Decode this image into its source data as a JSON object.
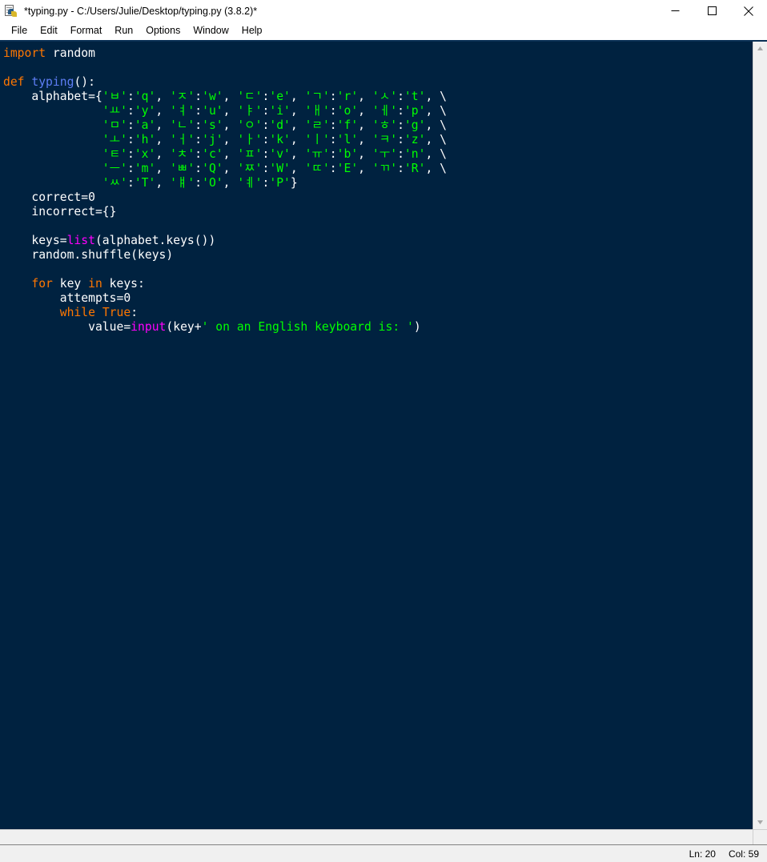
{
  "window": {
    "title": "*typing.py - C:/Users/Julie/Desktop/typing.py (3.8.2)*",
    "icon": "python-file-icon",
    "controls": {
      "minimize": "minimize-icon",
      "maximize": "maximize-icon",
      "close": "close-icon"
    }
  },
  "menubar": {
    "items": [
      {
        "label": "File"
      },
      {
        "label": "Edit"
      },
      {
        "label": "Format"
      },
      {
        "label": "Run"
      },
      {
        "label": "Options"
      },
      {
        "label": "Window"
      },
      {
        "label": "Help"
      }
    ]
  },
  "editor": {
    "lines": [
      [
        {
          "t": "import",
          "c": "kw"
        },
        {
          "t": " random",
          "c": "norm"
        }
      ],
      [
        {
          "t": "",
          "c": "norm"
        }
      ],
      [
        {
          "t": "def",
          "c": "kw"
        },
        {
          "t": " ",
          "c": "norm"
        },
        {
          "t": "typing",
          "c": "def"
        },
        {
          "t": "():",
          "c": "norm"
        }
      ],
      [
        {
          "t": "    alphabet={",
          "c": "norm"
        },
        {
          "t": "'ㅂ'",
          "c": "str"
        },
        {
          "t": ":",
          "c": "norm"
        },
        {
          "t": "'q'",
          "c": "str"
        },
        {
          "t": ", ",
          "c": "norm"
        },
        {
          "t": "'ㅈ'",
          "c": "str"
        },
        {
          "t": ":",
          "c": "norm"
        },
        {
          "t": "'w'",
          "c": "str"
        },
        {
          "t": ", ",
          "c": "norm"
        },
        {
          "t": "'ㄷ'",
          "c": "str"
        },
        {
          "t": ":",
          "c": "norm"
        },
        {
          "t": "'e'",
          "c": "str"
        },
        {
          "t": ", ",
          "c": "norm"
        },
        {
          "t": "'ㄱ'",
          "c": "str"
        },
        {
          "t": ":",
          "c": "norm"
        },
        {
          "t": "'r'",
          "c": "str"
        },
        {
          "t": ", ",
          "c": "norm"
        },
        {
          "t": "'ㅅ'",
          "c": "str"
        },
        {
          "t": ":",
          "c": "norm"
        },
        {
          "t": "'t'",
          "c": "str"
        },
        {
          "t": ", \\",
          "c": "norm"
        }
      ],
      [
        {
          "t": "              ",
          "c": "norm"
        },
        {
          "t": "'ㅛ'",
          "c": "str"
        },
        {
          "t": ":",
          "c": "norm"
        },
        {
          "t": "'y'",
          "c": "str"
        },
        {
          "t": ", ",
          "c": "norm"
        },
        {
          "t": "'ㅕ'",
          "c": "str"
        },
        {
          "t": ":",
          "c": "norm"
        },
        {
          "t": "'u'",
          "c": "str"
        },
        {
          "t": ", ",
          "c": "norm"
        },
        {
          "t": "'ㅑ'",
          "c": "str"
        },
        {
          "t": ":",
          "c": "norm"
        },
        {
          "t": "'i'",
          "c": "str"
        },
        {
          "t": ", ",
          "c": "norm"
        },
        {
          "t": "'ㅐ'",
          "c": "str"
        },
        {
          "t": ":",
          "c": "norm"
        },
        {
          "t": "'o'",
          "c": "str"
        },
        {
          "t": ", ",
          "c": "norm"
        },
        {
          "t": "'ㅔ'",
          "c": "str"
        },
        {
          "t": ":",
          "c": "norm"
        },
        {
          "t": "'p'",
          "c": "str"
        },
        {
          "t": ", \\",
          "c": "norm"
        }
      ],
      [
        {
          "t": "              ",
          "c": "norm"
        },
        {
          "t": "'ㅁ'",
          "c": "str"
        },
        {
          "t": ":",
          "c": "norm"
        },
        {
          "t": "'a'",
          "c": "str"
        },
        {
          "t": ", ",
          "c": "norm"
        },
        {
          "t": "'ㄴ'",
          "c": "str"
        },
        {
          "t": ":",
          "c": "norm"
        },
        {
          "t": "'s'",
          "c": "str"
        },
        {
          "t": ", ",
          "c": "norm"
        },
        {
          "t": "'ㅇ'",
          "c": "str"
        },
        {
          "t": ":",
          "c": "norm"
        },
        {
          "t": "'d'",
          "c": "str"
        },
        {
          "t": ", ",
          "c": "norm"
        },
        {
          "t": "'ㄹ'",
          "c": "str"
        },
        {
          "t": ":",
          "c": "norm"
        },
        {
          "t": "'f'",
          "c": "str"
        },
        {
          "t": ", ",
          "c": "norm"
        },
        {
          "t": "'ㅎ'",
          "c": "str"
        },
        {
          "t": ":",
          "c": "norm"
        },
        {
          "t": "'g'",
          "c": "str"
        },
        {
          "t": ", \\",
          "c": "norm"
        }
      ],
      [
        {
          "t": "              ",
          "c": "norm"
        },
        {
          "t": "'ㅗ'",
          "c": "str"
        },
        {
          "t": ":",
          "c": "norm"
        },
        {
          "t": "'h'",
          "c": "str"
        },
        {
          "t": ", ",
          "c": "norm"
        },
        {
          "t": "'ㅓ'",
          "c": "str"
        },
        {
          "t": ":",
          "c": "norm"
        },
        {
          "t": "'j'",
          "c": "str"
        },
        {
          "t": ", ",
          "c": "norm"
        },
        {
          "t": "'ㅏ'",
          "c": "str"
        },
        {
          "t": ":",
          "c": "norm"
        },
        {
          "t": "'k'",
          "c": "str"
        },
        {
          "t": ", ",
          "c": "norm"
        },
        {
          "t": "'ㅣ'",
          "c": "str"
        },
        {
          "t": ":",
          "c": "norm"
        },
        {
          "t": "'l'",
          "c": "str"
        },
        {
          "t": ", ",
          "c": "norm"
        },
        {
          "t": "'ㅋ'",
          "c": "str"
        },
        {
          "t": ":",
          "c": "norm"
        },
        {
          "t": "'z'",
          "c": "str"
        },
        {
          "t": ", \\",
          "c": "norm"
        }
      ],
      [
        {
          "t": "              ",
          "c": "norm"
        },
        {
          "t": "'ㅌ'",
          "c": "str"
        },
        {
          "t": ":",
          "c": "norm"
        },
        {
          "t": "'x'",
          "c": "str"
        },
        {
          "t": ", ",
          "c": "norm"
        },
        {
          "t": "'ㅊ'",
          "c": "str"
        },
        {
          "t": ":",
          "c": "norm"
        },
        {
          "t": "'c'",
          "c": "str"
        },
        {
          "t": ", ",
          "c": "norm"
        },
        {
          "t": "'ㅍ'",
          "c": "str"
        },
        {
          "t": ":",
          "c": "norm"
        },
        {
          "t": "'v'",
          "c": "str"
        },
        {
          "t": ", ",
          "c": "norm"
        },
        {
          "t": "'ㅠ'",
          "c": "str"
        },
        {
          "t": ":",
          "c": "norm"
        },
        {
          "t": "'b'",
          "c": "str"
        },
        {
          "t": ", ",
          "c": "norm"
        },
        {
          "t": "'ㅜ'",
          "c": "str"
        },
        {
          "t": ":",
          "c": "norm"
        },
        {
          "t": "'n'",
          "c": "str"
        },
        {
          "t": ", \\",
          "c": "norm"
        }
      ],
      [
        {
          "t": "              ",
          "c": "norm"
        },
        {
          "t": "'ㅡ'",
          "c": "str"
        },
        {
          "t": ":",
          "c": "norm"
        },
        {
          "t": "'m'",
          "c": "str"
        },
        {
          "t": ", ",
          "c": "norm"
        },
        {
          "t": "'ㅃ'",
          "c": "str"
        },
        {
          "t": ":",
          "c": "norm"
        },
        {
          "t": "'Q'",
          "c": "str"
        },
        {
          "t": ", ",
          "c": "norm"
        },
        {
          "t": "'ㅉ'",
          "c": "str"
        },
        {
          "t": ":",
          "c": "norm"
        },
        {
          "t": "'W'",
          "c": "str"
        },
        {
          "t": ", ",
          "c": "norm"
        },
        {
          "t": "'ㄸ'",
          "c": "str"
        },
        {
          "t": ":",
          "c": "norm"
        },
        {
          "t": "'E'",
          "c": "str"
        },
        {
          "t": ", ",
          "c": "norm"
        },
        {
          "t": "'ㄲ'",
          "c": "str"
        },
        {
          "t": ":",
          "c": "norm"
        },
        {
          "t": "'R'",
          "c": "str"
        },
        {
          "t": ", \\",
          "c": "norm"
        }
      ],
      [
        {
          "t": "              ",
          "c": "norm"
        },
        {
          "t": "'ㅆ'",
          "c": "str"
        },
        {
          "t": ":",
          "c": "norm"
        },
        {
          "t": "'T'",
          "c": "str"
        },
        {
          "t": ", ",
          "c": "norm"
        },
        {
          "t": "'ㅒ'",
          "c": "str"
        },
        {
          "t": ":",
          "c": "norm"
        },
        {
          "t": "'O'",
          "c": "str"
        },
        {
          "t": ", ",
          "c": "norm"
        },
        {
          "t": "'ㅖ'",
          "c": "str"
        },
        {
          "t": ":",
          "c": "norm"
        },
        {
          "t": "'P'",
          "c": "str"
        },
        {
          "t": "}",
          "c": "norm"
        }
      ],
      [
        {
          "t": "    correct=0",
          "c": "norm"
        }
      ],
      [
        {
          "t": "    incorrect={}",
          "c": "norm"
        }
      ],
      [
        {
          "t": "",
          "c": "norm"
        }
      ],
      [
        {
          "t": "    keys=",
          "c": "norm"
        },
        {
          "t": "list",
          "c": "bi"
        },
        {
          "t": "(alphabet.keys())",
          "c": "norm"
        }
      ],
      [
        {
          "t": "    random.shuffle(keys)",
          "c": "norm"
        }
      ],
      [
        {
          "t": "",
          "c": "norm"
        }
      ],
      [
        {
          "t": "    ",
          "c": "norm"
        },
        {
          "t": "for",
          "c": "kw"
        },
        {
          "t": " key ",
          "c": "norm"
        },
        {
          "t": "in",
          "c": "kw"
        },
        {
          "t": " keys:",
          "c": "norm"
        }
      ],
      [
        {
          "t": "        attempts=0",
          "c": "norm"
        }
      ],
      [
        {
          "t": "        ",
          "c": "norm"
        },
        {
          "t": "while",
          "c": "kw"
        },
        {
          "t": " ",
          "c": "norm"
        },
        {
          "t": "True",
          "c": "kw"
        },
        {
          "t": ":",
          "c": "norm"
        }
      ],
      [
        {
          "t": "            value=",
          "c": "norm"
        },
        {
          "t": "input",
          "c": "bi"
        },
        {
          "t": "(key+",
          "c": "norm"
        },
        {
          "t": "' on an English keyboard is: '",
          "c": "str"
        },
        {
          "t": ")",
          "c": "norm"
        }
      ]
    ],
    "colors": {
      "background": "#002240",
      "normal": "#ffffff",
      "keyword": "#ff7700",
      "definition": "#5e7ef5",
      "builtin": "#ff00ff",
      "string": "#00ff00"
    }
  },
  "scrollbars": {
    "vertical_up_arrow": "chevron-up-icon",
    "vertical_down_arrow": "chevron-down-icon"
  },
  "statusbar": {
    "line": "Ln: 20",
    "column": "Col: 59"
  }
}
